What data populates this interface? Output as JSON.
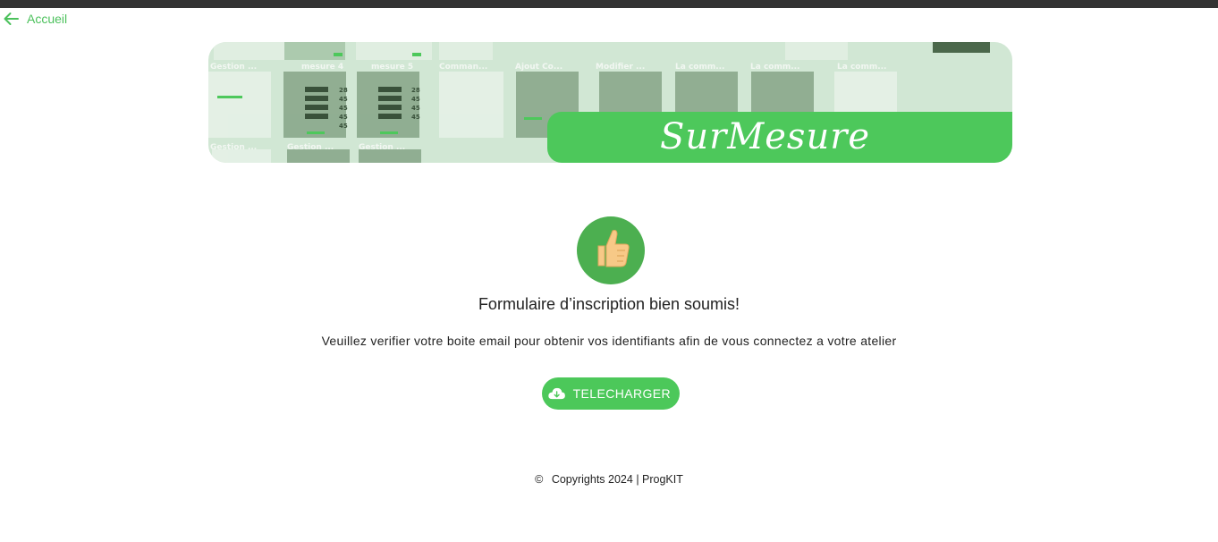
{
  "nav": {
    "back_label": "Accueil"
  },
  "banner": {
    "brand_name": "SurMesure",
    "mock_labels": [
      "Gestion ...",
      "mesure 4",
      "mesure 5",
      "Comman...",
      "Ajout Co...",
      "Modifier ...",
      "La comm...",
      "La comm...",
      "La comm...",
      "Gestion ...",
      "Gestion ...",
      "Gestion ..."
    ],
    "mock_values": [
      "28",
      "45",
      "45",
      "45",
      "45",
      "28",
      "45",
      "45",
      "45"
    ]
  },
  "content": {
    "title": "Formulaire d’inscription bien soumis!",
    "message": "Veuillez verifier votre boite email pour obtenir vos identifiants afin de vous connectez a votre atelier"
  },
  "actions": {
    "download_label": "TELECHARGER"
  },
  "footer": {
    "copyright_symbol": "©",
    "text": "Copyrights 2024 | ProgKIT"
  },
  "colors": {
    "accent": "#4cc85a",
    "accent_dark": "#4caf50",
    "banner_bg": "#d1e7d4",
    "thumb_skin": "#f7c987",
    "topbar": "#333333"
  }
}
